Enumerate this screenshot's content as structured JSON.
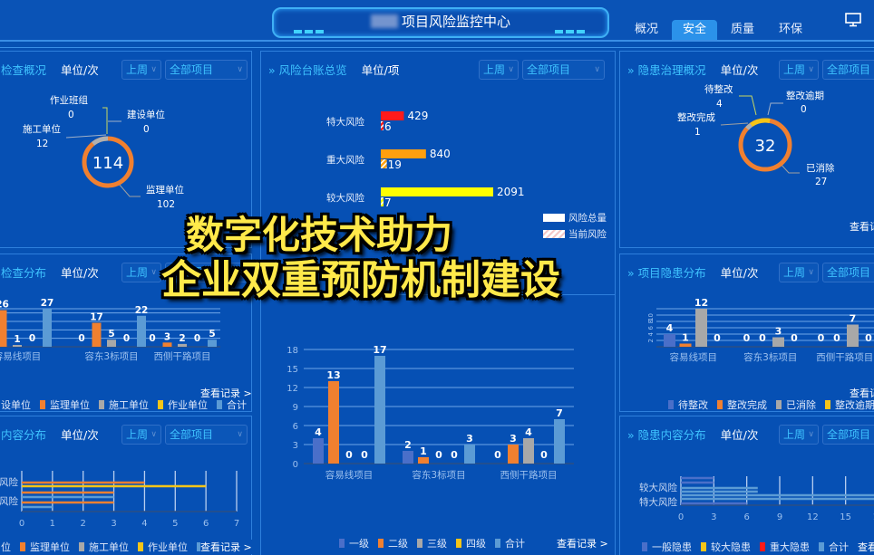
{
  "header": {
    "title": "项目风险监控中心",
    "tabs": [
      {
        "label": "概况",
        "active": false
      },
      {
        "label": "安全",
        "active": true
      },
      {
        "label": "质量",
        "active": false
      },
      {
        "label": "环保",
        "active": false
      }
    ],
    "monitor_icon": "monitor-icon"
  },
  "filters": {
    "period": "上周",
    "project": "全部项目"
  },
  "common": {
    "unit_times": "单位/次",
    "unit_items": "单位/项",
    "view_records": "查看记录 >",
    "view_records_cut": "查看记"
  },
  "panels": {
    "inspection_overview": {
      "title": "检查概况",
      "total": "114",
      "segments": [
        {
          "name": "作业班组",
          "value": 0,
          "color": "#f5c518"
        },
        {
          "name": "建设单位",
          "value": 0,
          "color": "#8fa8c8"
        },
        {
          "name": "施工单位",
          "value": 12,
          "color": "#b0b0b0"
        },
        {
          "name": "监理单位",
          "value": 102,
          "color": "#f08030"
        }
      ]
    },
    "risk_ledger": {
      "title": "风险台账总览",
      "legend": [
        "风险总量",
        "当前风险"
      ]
    },
    "hazard_overview": {
      "title": "隐患治理概况",
      "total": "32",
      "segments": [
        {
          "name": "待整改",
          "value": 4,
          "color": "#f5c518"
        },
        {
          "name": "整改逾期",
          "value": 0,
          "color": "#8fa8c8"
        },
        {
          "name": "整改完成",
          "value": 1,
          "color": "#b0b0b0"
        },
        {
          "name": "已消除",
          "value": 27,
          "color": "#f08030"
        }
      ]
    },
    "inspection_distribution": {
      "title": "检查分布",
      "legend": [
        "设单位",
        "监理单位",
        "施工单位",
        "作业单位",
        "合计"
      ]
    },
    "project_hazard_distribution": {
      "title": "项目隐患分布",
      "legend": [
        "待整改",
        "整改完成",
        "已消除",
        "整改逾期"
      ]
    },
    "content_distribution": {
      "title": "内容分布",
      "legend": [
        "位",
        "监理单位",
        "施工单位",
        "作业单位",
        "合计"
      ]
    },
    "hazard_content_distribution": {
      "title": "隐患内容分布",
      "legend": [
        "一般隐患",
        "较大隐患",
        "重大隐患",
        "合计"
      ]
    },
    "risk_level_distribution": {
      "legend": [
        "一级",
        "二级",
        "三级",
        "四级",
        "合计"
      ]
    }
  },
  "overlay": {
    "line1": "数字化技术助力",
    "line2": "企业双重预防机制建设"
  },
  "chart_data": [
    {
      "id": "inspection_overview",
      "type": "pie",
      "title": "检查概况",
      "labels": [
        "作业班组",
        "建设单位",
        "施工单位",
        "监理单位"
      ],
      "values": [
        0,
        0,
        12,
        102
      ],
      "center_label": "114"
    },
    {
      "id": "risk_ledger",
      "type": "bar",
      "orientation": "horizontal",
      "title": "风险台账总览",
      "categories": [
        "特大风险",
        "重大风险",
        "较大风险"
      ],
      "series": [
        {
          "name": "风险总量",
          "values": [
            429,
            840,
            2091
          ]
        },
        {
          "name": "当前风险",
          "values": [
            6,
            19,
            7
          ]
        }
      ],
      "colors": [
        "#ff1a1a",
        "#ff9f0f",
        "#ffff00"
      ]
    },
    {
      "id": "hazard_overview",
      "type": "pie",
      "title": "隐患治理概况",
      "labels": [
        "待整改",
        "整改逾期",
        "整改完成",
        "已消除"
      ],
      "values": [
        4,
        0,
        1,
        27
      ],
      "center_label": "32"
    },
    {
      "id": "inspection_distribution",
      "type": "bar",
      "title": "检查分布",
      "categories": [
        "容易线项目",
        "容东3标项目",
        "西侧干路项目"
      ],
      "series": [
        {
          "name": "建设单位",
          "values": [
            0,
            0,
            0
          ],
          "color": "#8fa8c8"
        },
        {
          "name": "监理单位",
          "values": [
            26,
            17,
            3
          ],
          "color": "#f08030"
        },
        {
          "name": "施工单位",
          "values": [
            1,
            5,
            2
          ],
          "color": "#a8a8a8"
        },
        {
          "name": "作业单位",
          "values": [
            0,
            0,
            0
          ],
          "color": "#f5c518"
        },
        {
          "name": "合计",
          "values": [
            27,
            22,
            5
          ],
          "color": "#5b9bd5"
        }
      ]
    },
    {
      "id": "project_hazard_distribution",
      "type": "bar",
      "title": "项目隐患分布",
      "categories": [
        "容易线项目",
        "容东3标项目",
        "西侧干路项目"
      ],
      "series": [
        {
          "name": "待整改",
          "values": [
            4,
            0,
            0
          ],
          "color": "#4a6fc9"
        },
        {
          "name": "整改完成",
          "values": [
            1,
            0,
            0
          ],
          "color": "#f08030"
        },
        {
          "name": "已消除",
          "values": [
            12,
            3,
            7
          ],
          "color": "#a8a8a8"
        },
        {
          "name": "整改逾期",
          "values": [
            0,
            0,
            0
          ],
          "color": "#f5c518"
        }
      ],
      "yticks": [
        2,
        4,
        6,
        8,
        10
      ]
    },
    {
      "id": "risk_level_distribution",
      "type": "bar",
      "categories": [
        "容易线项目",
        "容东3标项目",
        "西侧干路项目"
      ],
      "series": [
        {
          "name": "一级",
          "values": [
            4,
            2,
            0
          ],
          "color": "#4a6fc9"
        },
        {
          "name": "二级",
          "values": [
            13,
            1,
            3
          ],
          "color": "#f08030"
        },
        {
          "name": "三级",
          "values": [
            0,
            0,
            4
          ],
          "color": "#a8a8a8"
        },
        {
          "name": "四级",
          "values": [
            0,
            0,
            0
          ],
          "color": "#f5c518"
        },
        {
          "name": "合计",
          "values": [
            17,
            3,
            7
          ],
          "color": "#5b9bd5"
        }
      ],
      "ylim": [
        0,
        18
      ],
      "yticks": [
        0,
        3,
        6,
        9,
        12,
        15,
        18
      ]
    },
    {
      "id": "content_distribution",
      "type": "bar",
      "orientation": "horizontal",
      "title": "内容分布",
      "categories": [
        "较大风险",
        "重大风险"
      ],
      "series": [
        {
          "name": "监理单位",
          "values": [
            4,
            3
          ],
          "color": "#f08030"
        },
        {
          "name": "作业单位",
          "values": [
            6,
            0
          ],
          "color": "#f5c518"
        },
        {
          "name": "合计",
          "values": [
            3,
            1
          ],
          "color": "#5b9bd5"
        }
      ],
      "xlim": [
        0,
        7
      ],
      "xticks": [
        0,
        1,
        2,
        3,
        4,
        5,
        6,
        7
      ]
    },
    {
      "id": "hazard_content_distribution",
      "type": "bar",
      "orientation": "horizontal",
      "title": "隐患内容分布",
      "categories": [
        "较大风险",
        "特大风险"
      ],
      "series": [
        {
          "name": "一般隐患",
          "values": [
            3,
            6
          ],
          "color": "#4a6fc9"
        },
        {
          "name": "合计",
          "values": [
            7,
            22
          ],
          "color": "#5b9bd5"
        }
      ],
      "xlim": [
        0,
        18
      ],
      "xticks": [
        0,
        3,
        6,
        9,
        12,
        15,
        18
      ]
    }
  ]
}
